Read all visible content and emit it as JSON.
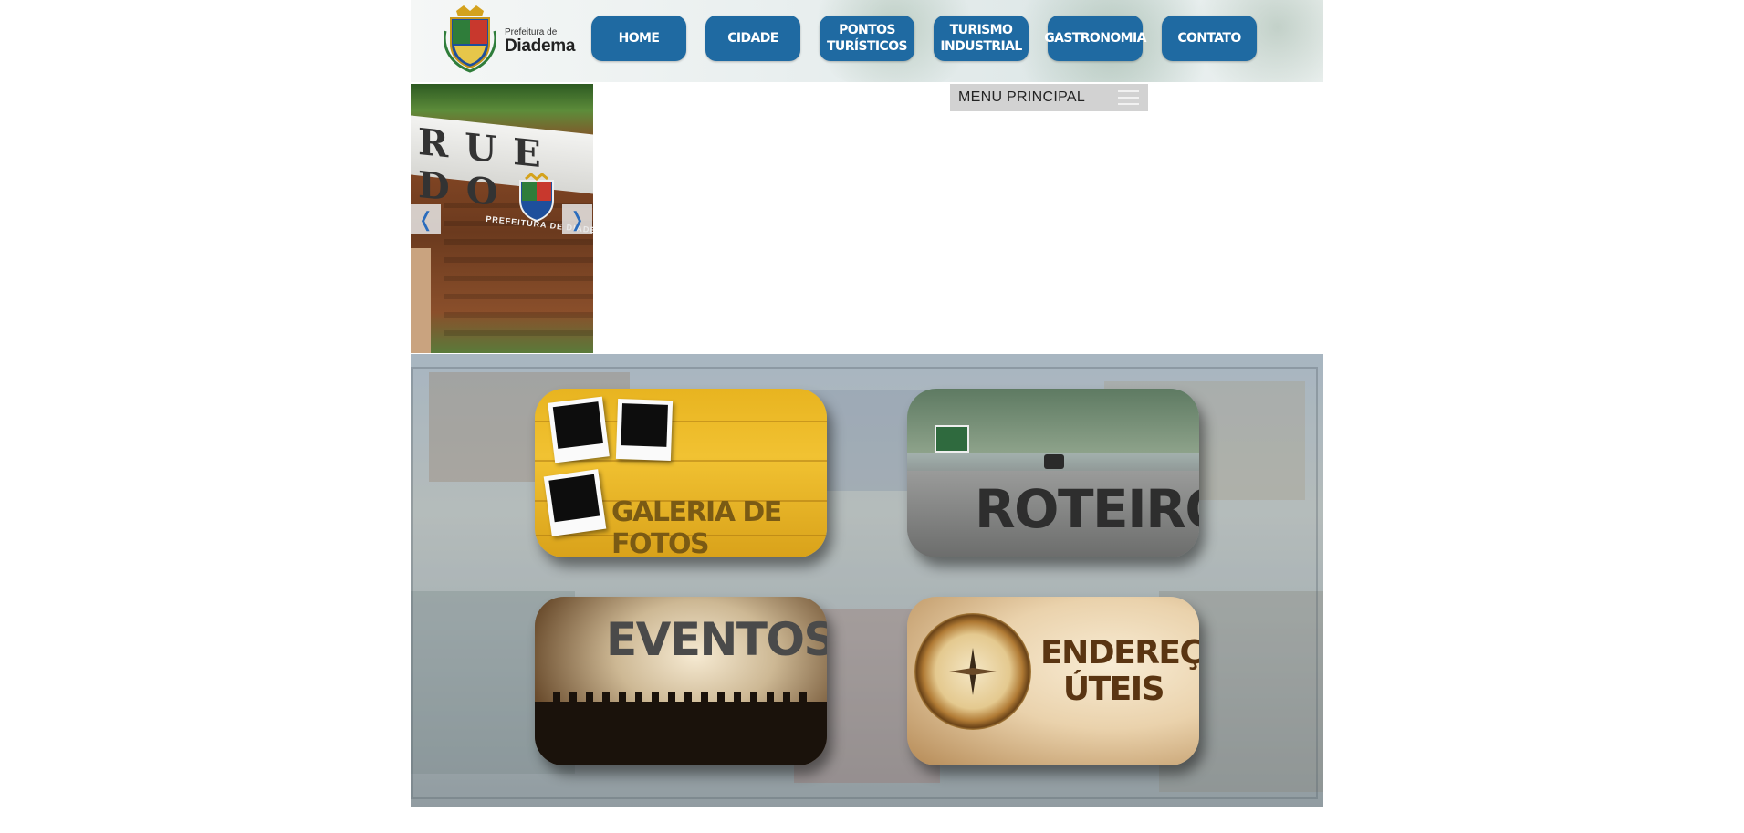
{
  "header": {
    "logo_small": "Prefeitura de",
    "logo_big": "Diadema",
    "nav": [
      {
        "label": "HOME"
      },
      {
        "label": "CIDADE"
      },
      {
        "label": "PONTOS\nTURÍSTICOS"
      },
      {
        "label": "TURISMO\nINDUSTRIAL"
      },
      {
        "label": "GASTRONOMIA"
      },
      {
        "label": "CONTATO"
      }
    ]
  },
  "slider": {
    "caption": "PREFEITURA DE DIADEMA",
    "sign_letters": "RUE DO",
    "prev_label": "❬",
    "next_label": "❭"
  },
  "menu": {
    "label": "MENU PRINCIPAL"
  },
  "tiles": [
    {
      "label": "GALERIA DE FOTOS"
    },
    {
      "label": "ROTEIRO"
    },
    {
      "label": "EVENTOS"
    },
    {
      "label": "ENDEREÇOS\nÚTEIS"
    }
  ],
  "colors": {
    "nav_blue": "#1f6aa2",
    "menu_bar": "#d2d2d2",
    "slider_arrow": "#2a6cbd"
  }
}
